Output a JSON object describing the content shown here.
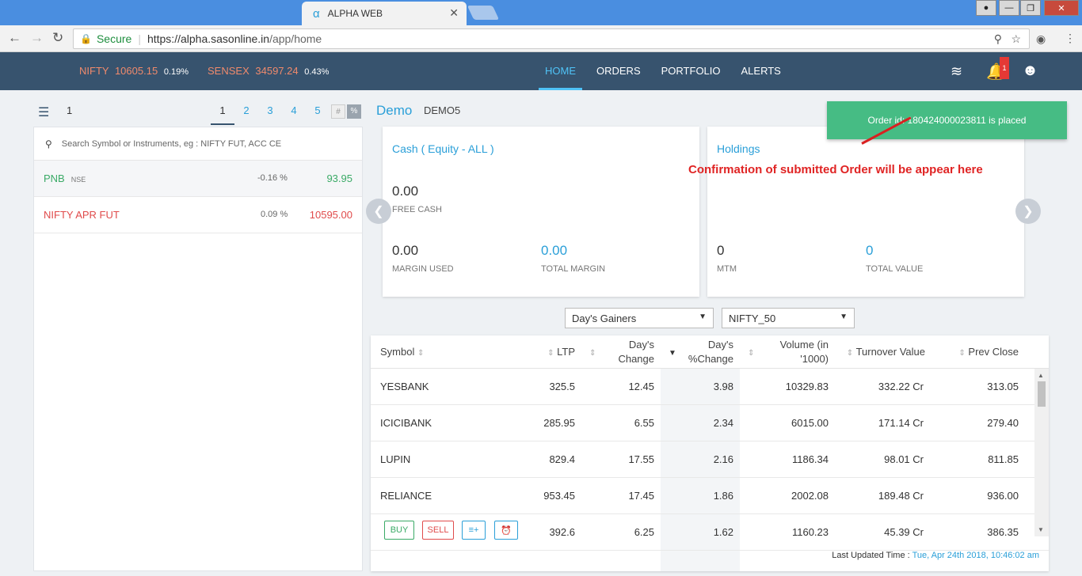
{
  "browser": {
    "tab_title": "ALPHA WEB",
    "secure_label": "Secure",
    "url_host": "https://alpha.sasonline.in",
    "url_path": "/app/home"
  },
  "header": {
    "tickers": [
      {
        "name": "NIFTY",
        "value": "10605.15",
        "change": "0.19%"
      },
      {
        "name": "SENSEX",
        "value": "34597.24",
        "change": "0.43%"
      }
    ],
    "nav": [
      "HOME",
      "ORDERS",
      "PORTFOLIO",
      "ALERTS"
    ],
    "notification_count": "1"
  },
  "watchlist": {
    "current": "1",
    "pages": [
      "1",
      "2",
      "3",
      "4",
      "5"
    ],
    "mode_hash": "#",
    "mode_pct": "%",
    "search_placeholder": "Search Symbol or Instruments, eg : NIFTY FUT, ACC CE",
    "items": [
      {
        "symbol": "PNB",
        "exchange": "NSE",
        "change_pct": "-0.16 %",
        "ltp": "93.95",
        "color": "#3aaa66"
      },
      {
        "symbol": "NIFTY APR FUT",
        "exchange": "",
        "change_pct": "0.09 %",
        "ltp": "10595.00",
        "color": "#e04b4b"
      }
    ]
  },
  "account": {
    "name": "Demo",
    "id": "DEMO5"
  },
  "cash_card": {
    "title": "Cash ( Equity - ALL )",
    "free_cash_value": "0.00",
    "free_cash_label": "FREE CASH",
    "margin_used_value": "0.00",
    "margin_used_label": "MARGIN USED",
    "total_margin_value": "0.00",
    "total_margin_label": "TOTAL MARGIN"
  },
  "holdings_card": {
    "title": "Holdings",
    "mtm_value": "0",
    "mtm_label": "MTM",
    "total_value": "0",
    "total_value_label": "TOTAL VALUE"
  },
  "toast": {
    "message": "Order id: 180424000023811 is placed"
  },
  "annotation": {
    "text": "Confirmation of submitted Order will be appear here"
  },
  "filters": {
    "gainers": "Day's Gainers",
    "index": "NIFTY_50"
  },
  "gainers_table": {
    "headers": {
      "symbol": "Symbol",
      "ltp": "LTP",
      "day_change_1": "Day's",
      "day_change_2": "Change",
      "pct_change_1": "Day's",
      "pct_change_2": "%Change",
      "volume_1": "Volume (in",
      "volume_2": "'1000)",
      "turnover": "Turnover Value",
      "prev_close": "Prev Close"
    },
    "rows": [
      {
        "symbol": "YESBANK",
        "ltp": "325.5",
        "change": "12.45",
        "pct": "3.98",
        "volume": "10329.83",
        "turnover": "332.22 Cr",
        "prev": "313.05"
      },
      {
        "symbol": "ICICIBANK",
        "ltp": "285.95",
        "change": "6.55",
        "pct": "2.34",
        "volume": "6015.00",
        "turnover": "171.14 Cr",
        "prev": "279.40"
      },
      {
        "symbol": "LUPIN",
        "ltp": "829.4",
        "change": "17.55",
        "pct": "2.16",
        "volume": "1186.34",
        "turnover": "98.01 Cr",
        "prev": "811.85"
      },
      {
        "symbol": "RELIANCE",
        "ltp": "953.45",
        "change": "17.45",
        "pct": "1.86",
        "volume": "2002.08",
        "turnover": "189.48 Cr",
        "prev": "936.00"
      },
      {
        "symbol": "",
        "ltp": "392.6",
        "change": "6.25",
        "pct": "1.62",
        "volume": "1160.23",
        "turnover": "45.39 Cr",
        "prev": "386.35"
      }
    ],
    "buy_label": "BUY",
    "sell_label": "SELL",
    "last_updated_label": "Last Updated Time : ",
    "last_updated_value": "Tue, Apr 24th 2018, 10:46:02 am"
  }
}
